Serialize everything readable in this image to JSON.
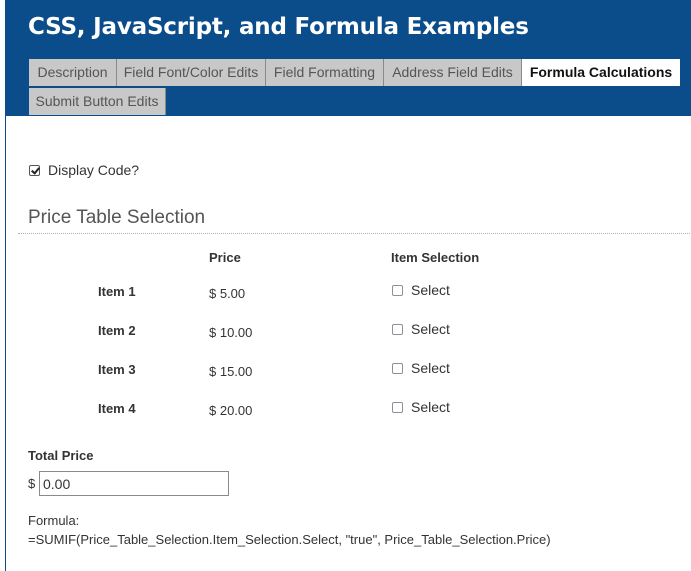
{
  "header": {
    "title": "CSS, JavaScript, and Formula Examples",
    "background_color": "#0b4c8a"
  },
  "tabs": [
    {
      "label": "Description",
      "active": false
    },
    {
      "label": "Field Font/Color Edits",
      "active": false
    },
    {
      "label": "Field Formatting",
      "active": false
    },
    {
      "label": "Address Field Edits",
      "active": false
    },
    {
      "label": "Formula Calculations",
      "active": true
    },
    {
      "label": "Submit Button Edits",
      "active": false
    }
  ],
  "display_code": {
    "label": "Display Code?",
    "checked": true
  },
  "price_table": {
    "title": "Price Table Selection",
    "columns": {
      "price": "Price",
      "item_selection": "Item Selection"
    },
    "rows": [
      {
        "name": "Item 1",
        "price": "$ 5.00",
        "select_label": "Select",
        "selected": false
      },
      {
        "name": "Item 2",
        "price": "$ 10.00",
        "select_label": "Select",
        "selected": false
      },
      {
        "name": "Item 3",
        "price": "$ 15.00",
        "select_label": "Select",
        "selected": false
      },
      {
        "name": "Item 4",
        "price": "$ 20.00",
        "select_label": "Select",
        "selected": false
      }
    ]
  },
  "total": {
    "label": "Total Price",
    "currency": "$",
    "value": "0.00"
  },
  "formula": {
    "label": "Formula:",
    "expression": "=SUMIF(Price_Table_Selection.Item_Selection.Select, \"true\", Price_Table_Selection.Price)"
  }
}
